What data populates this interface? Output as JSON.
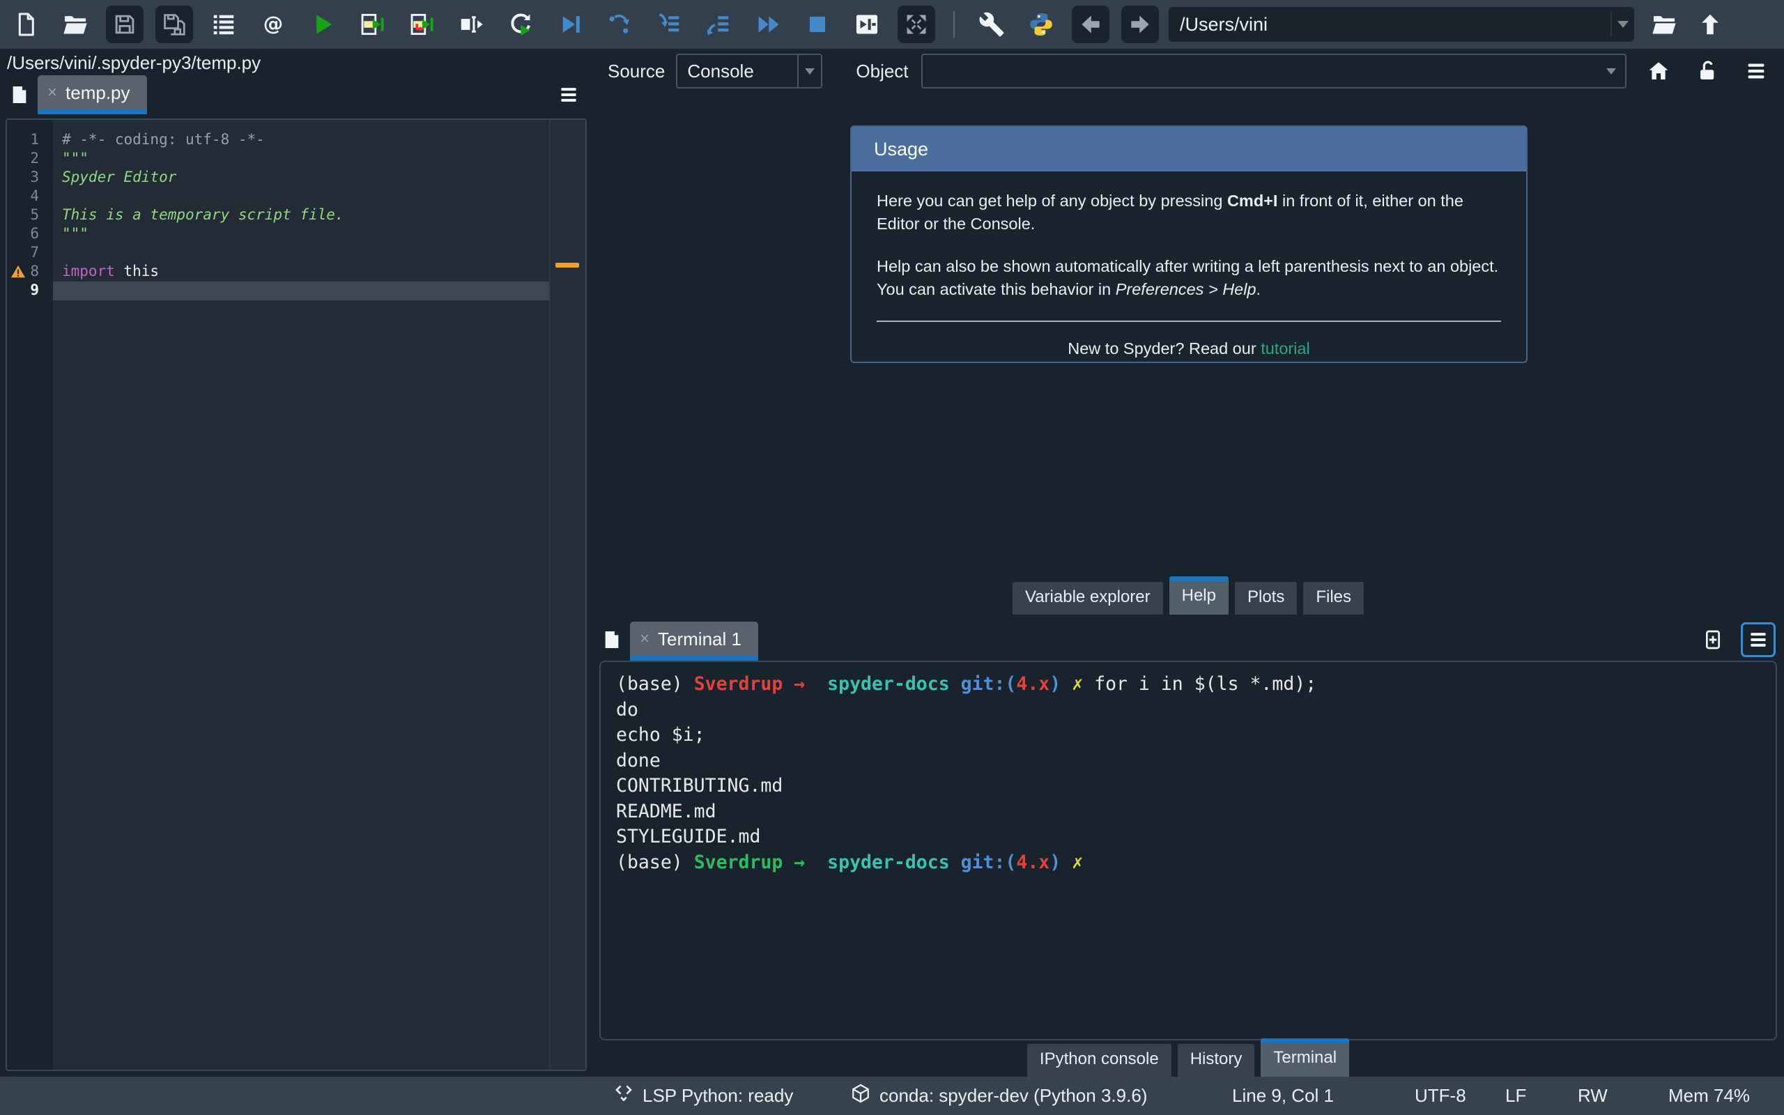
{
  "icons": {
    "close": "×"
  },
  "colors": {
    "accent": "#1B75BD",
    "usage_header": "#4A6E9E",
    "link": "#26A984",
    "warning": "#ECA227",
    "toolbar_bg": "#333F4D",
    "panel_bg": "#19232D",
    "statusbar_bg": "#37424F"
  },
  "toolbar": {
    "path_value": "/Users/vini",
    "buttons": [
      "new-file",
      "open-file",
      "save",
      "save-all",
      "file-switcher",
      "find-symbols",
      "run-file",
      "run-cell",
      "run-cell-advance",
      "run-selection",
      "rerun-cell",
      "debug-file",
      "step-over",
      "step-into",
      "step-return",
      "debug-continue",
      "debug-stop",
      "maximize-pane",
      "fullscreen",
      "separator",
      "preferences",
      "python-path",
      "history-back",
      "history-forward"
    ],
    "right_buttons": [
      "open-directory",
      "up-directory"
    ]
  },
  "editor": {
    "path": "/Users/vini/.spyder-py3/temp.py",
    "tab_label": "temp.py",
    "lines": [
      {
        "n": 1,
        "segs": [
          [
            "# -*- coding: utf-8 -*-",
            "com"
          ]
        ]
      },
      {
        "n": 2,
        "segs": [
          [
            "\"\"\"",
            "str"
          ]
        ]
      },
      {
        "n": 3,
        "segs": [
          [
            "Spyder Editor",
            "stri"
          ]
        ]
      },
      {
        "n": 4,
        "segs": []
      },
      {
        "n": 5,
        "segs": [
          [
            "This is a temporary script file.",
            "stri"
          ]
        ]
      },
      {
        "n": 6,
        "segs": [
          [
            "\"\"\"",
            "str"
          ]
        ]
      },
      {
        "n": 7,
        "segs": []
      },
      {
        "n": 8,
        "warn": true,
        "segs": [
          [
            "import",
            "kw"
          ],
          [
            " this",
            "pl"
          ]
        ]
      },
      {
        "n": 9,
        "cur": true,
        "segs": []
      }
    ]
  },
  "help": {
    "source_label": "Source",
    "source_value": "Console",
    "object_label": "Object",
    "object_value": "",
    "tabs": {
      "labels": [
        "Variable explorer",
        "Help",
        "Plots",
        "Files"
      ],
      "active": 1
    },
    "usage": {
      "title": "Usage",
      "p1_pre": "Here you can get help of any object by pressing ",
      "p1_bold": "Cmd+I",
      "p1_post": " in front of it, either on the Editor or the Console.",
      "p2_pre": "Help can also be shown automatically after writing a left parenthesis next to an object. You can activate this behavior in ",
      "p2_italic": "Preferences > Help",
      "p2_post": ".",
      "footer_pre": "New to Spyder? Read our ",
      "footer_link": "tutorial"
    }
  },
  "terminal": {
    "tab_label": "Terminal 1",
    "tabs": {
      "labels": [
        "IPython console",
        "History",
        "Terminal"
      ],
      "active": 2
    },
    "lines": [
      [
        [
          "(base) ",
          "w"
        ],
        [
          "Sverdrup",
          "r"
        ],
        [
          " →  ",
          "r"
        ],
        [
          "spyder-docs",
          "t"
        ],
        [
          " git:(",
          "b"
        ],
        [
          "4.x",
          "r"
        ],
        [
          ")",
          "b"
        ],
        [
          " ✗",
          "y"
        ],
        [
          " for i in $(ls *.md);",
          "w"
        ]
      ],
      [
        [
          "do",
          "w"
        ]
      ],
      [
        [
          "echo $i;",
          "w"
        ]
      ],
      [
        [
          "done",
          "w"
        ]
      ],
      [
        [
          "CONTRIBUTING.md",
          "w"
        ]
      ],
      [
        [
          "README.md",
          "w"
        ]
      ],
      [
        [
          "STYLEGUIDE.md",
          "w"
        ]
      ],
      [
        [
          "(base) ",
          "w"
        ],
        [
          "Sverdrup",
          "g"
        ],
        [
          " →  ",
          "g"
        ],
        [
          "spyder-docs",
          "t"
        ],
        [
          " git:(",
          "b"
        ],
        [
          "4.x",
          "r"
        ],
        [
          ")",
          "b"
        ],
        [
          " ✗",
          "y"
        ]
      ]
    ]
  },
  "statusbar": {
    "lsp": "LSP Python: ready",
    "conda": "conda: spyder-dev (Python 3.9.6)",
    "cursor": "Line 9, Col 1",
    "encoding": "UTF-8",
    "eol": "LF",
    "permissions": "RW",
    "memory": "Mem 74%"
  }
}
